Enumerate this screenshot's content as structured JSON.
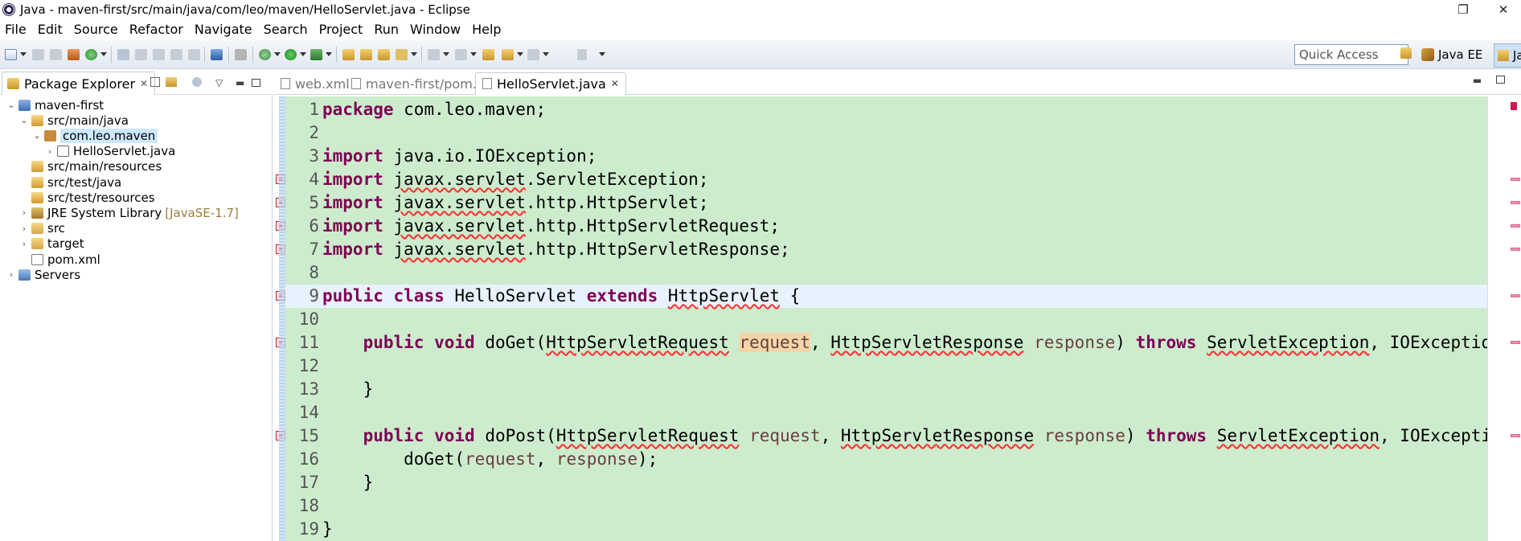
{
  "window": {
    "title": "Java - maven-first/src/main/java/com/leo/maven/HelloServlet.java - Eclipse",
    "restore_glyph": "❐",
    "close_glyph": "✕"
  },
  "menu": [
    "File",
    "Edit",
    "Source",
    "Refactor",
    "Navigate",
    "Search",
    "Project",
    "Run",
    "Window",
    "Help"
  ],
  "toolbar": {
    "quick_access_placeholder": "Quick Access",
    "perspective_java_ee": "Java EE",
    "perspective_java": "Java"
  },
  "package_explorer": {
    "tab_label": "Package Explorer",
    "tree": [
      {
        "label": "maven-first",
        "icon": "project-icon",
        "level": 0,
        "expanded": true
      },
      {
        "label": "src/main/java",
        "icon": "source-folder-icon",
        "level": 1,
        "expanded": true
      },
      {
        "label": "com.leo.maven",
        "icon": "package-icon",
        "level": 2,
        "expanded": true,
        "selected": true
      },
      {
        "label": "HelloServlet.java",
        "icon": "java-file-icon",
        "level": 3,
        "expanded": false
      },
      {
        "label": "src/main/resources",
        "icon": "source-folder-icon",
        "level": 1
      },
      {
        "label": "src/test/java",
        "icon": "source-folder-icon",
        "level": 1
      },
      {
        "label": "src/test/resources",
        "icon": "source-folder-icon",
        "level": 1
      },
      {
        "label": "JRE System Library",
        "decoration": "[JavaSE-1.7]",
        "icon": "library-icon",
        "level": 1,
        "expanded": false
      },
      {
        "label": "src",
        "icon": "folder-icon",
        "level": 1,
        "expanded": false
      },
      {
        "label": "target",
        "icon": "folder-icon",
        "level": 1,
        "expanded": false
      },
      {
        "label": "pom.xml",
        "icon": "xml-file-icon",
        "level": 1
      },
      {
        "label": "Servers",
        "icon": "servers-icon",
        "level": 0,
        "expanded": false
      }
    ]
  },
  "editor": {
    "tabs": [
      {
        "label": "web.xml",
        "active": false
      },
      {
        "label": "maven-first/pom.xml",
        "active": false
      },
      {
        "label": "HelloServlet.java",
        "active": true
      }
    ],
    "current_line": 9,
    "lines": [
      {
        "n": "1",
        "tokens": [
          {
            "t": "package",
            "c": "kw"
          },
          {
            "t": " com.leo.maven;"
          }
        ]
      },
      {
        "n": "2",
        "tokens": []
      },
      {
        "n": "3",
        "tokens": [
          {
            "t": "import",
            "c": "kw"
          },
          {
            "t": " java.io.IOException;"
          }
        ]
      },
      {
        "n": "4",
        "err": true,
        "tokens": [
          {
            "t": "import",
            "c": "kw"
          },
          {
            "t": " "
          },
          {
            "t": "javax.servlet",
            "c": "err"
          },
          {
            "t": ".ServletException;"
          }
        ]
      },
      {
        "n": "5",
        "err": true,
        "tokens": [
          {
            "t": "import",
            "c": "kw"
          },
          {
            "t": " "
          },
          {
            "t": "javax.servlet",
            "c": "err"
          },
          {
            "t": ".http.HttpServlet;"
          }
        ]
      },
      {
        "n": "6",
        "err": true,
        "tokens": [
          {
            "t": "import",
            "c": "kw"
          },
          {
            "t": " "
          },
          {
            "t": "javax.servlet",
            "c": "err"
          },
          {
            "t": ".http.HttpServletRequest;"
          }
        ]
      },
      {
        "n": "7",
        "err": true,
        "tokens": [
          {
            "t": "import",
            "c": "kw"
          },
          {
            "t": " "
          },
          {
            "t": "javax.servlet",
            "c": "err"
          },
          {
            "t": ".http.HttpServletResponse;"
          }
        ]
      },
      {
        "n": "8",
        "tokens": []
      },
      {
        "n": "9",
        "err": true,
        "tokens": [
          {
            "t": "public",
            "c": "kw"
          },
          {
            "t": " "
          },
          {
            "t": "class",
            "c": "kw"
          },
          {
            "t": " HelloServlet "
          },
          {
            "t": "extends",
            "c": "kw"
          },
          {
            "t": " "
          },
          {
            "t": "HttpServlet",
            "c": "err"
          },
          {
            "t": " {"
          }
        ]
      },
      {
        "n": "10",
        "tokens": []
      },
      {
        "n": "11",
        "err": true,
        "tokens": [
          {
            "t": "    "
          },
          {
            "t": "public",
            "c": "kw"
          },
          {
            "t": " "
          },
          {
            "t": "void",
            "c": "kw"
          },
          {
            "t": " doGet("
          },
          {
            "t": "HttpServletRequest",
            "c": "err"
          },
          {
            "t": " "
          },
          {
            "t": "request",
            "c": "param hl"
          },
          {
            "t": ", "
          },
          {
            "t": "HttpServletResponse",
            "c": "err"
          },
          {
            "t": " "
          },
          {
            "t": "response",
            "c": "param"
          },
          {
            "t": ") "
          },
          {
            "t": "throws",
            "c": "kw"
          },
          {
            "t": " "
          },
          {
            "t": "ServletException",
            "c": "err"
          },
          {
            "t": ", IOException {"
          }
        ]
      },
      {
        "n": "12",
        "tokens": []
      },
      {
        "n": "13",
        "tokens": [
          {
            "t": "    }"
          }
        ]
      },
      {
        "n": "14",
        "tokens": []
      },
      {
        "n": "15",
        "err": true,
        "tokens": [
          {
            "t": "    "
          },
          {
            "t": "public",
            "c": "kw"
          },
          {
            "t": " "
          },
          {
            "t": "void",
            "c": "kw"
          },
          {
            "t": " doPost("
          },
          {
            "t": "HttpServletRequest",
            "c": "err"
          },
          {
            "t": " "
          },
          {
            "t": "request",
            "c": "param"
          },
          {
            "t": ", "
          },
          {
            "t": "HttpServletResponse",
            "c": "err"
          },
          {
            "t": " "
          },
          {
            "t": "response",
            "c": "param"
          },
          {
            "t": ") "
          },
          {
            "t": "throws",
            "c": "kw"
          },
          {
            "t": " "
          },
          {
            "t": "ServletException",
            "c": "err"
          },
          {
            "t": ", IOException {"
          }
        ]
      },
      {
        "n": "16",
        "tokens": [
          {
            "t": "        doGet("
          },
          {
            "t": "request",
            "c": "param"
          },
          {
            "t": ", "
          },
          {
            "t": "response",
            "c": "param"
          },
          {
            "t": ");"
          }
        ]
      },
      {
        "n": "17",
        "tokens": [
          {
            "t": "    }"
          }
        ]
      },
      {
        "n": "18",
        "tokens": []
      },
      {
        "n": "19",
        "tokens": [
          {
            "t": "}"
          }
        ]
      }
    ]
  }
}
